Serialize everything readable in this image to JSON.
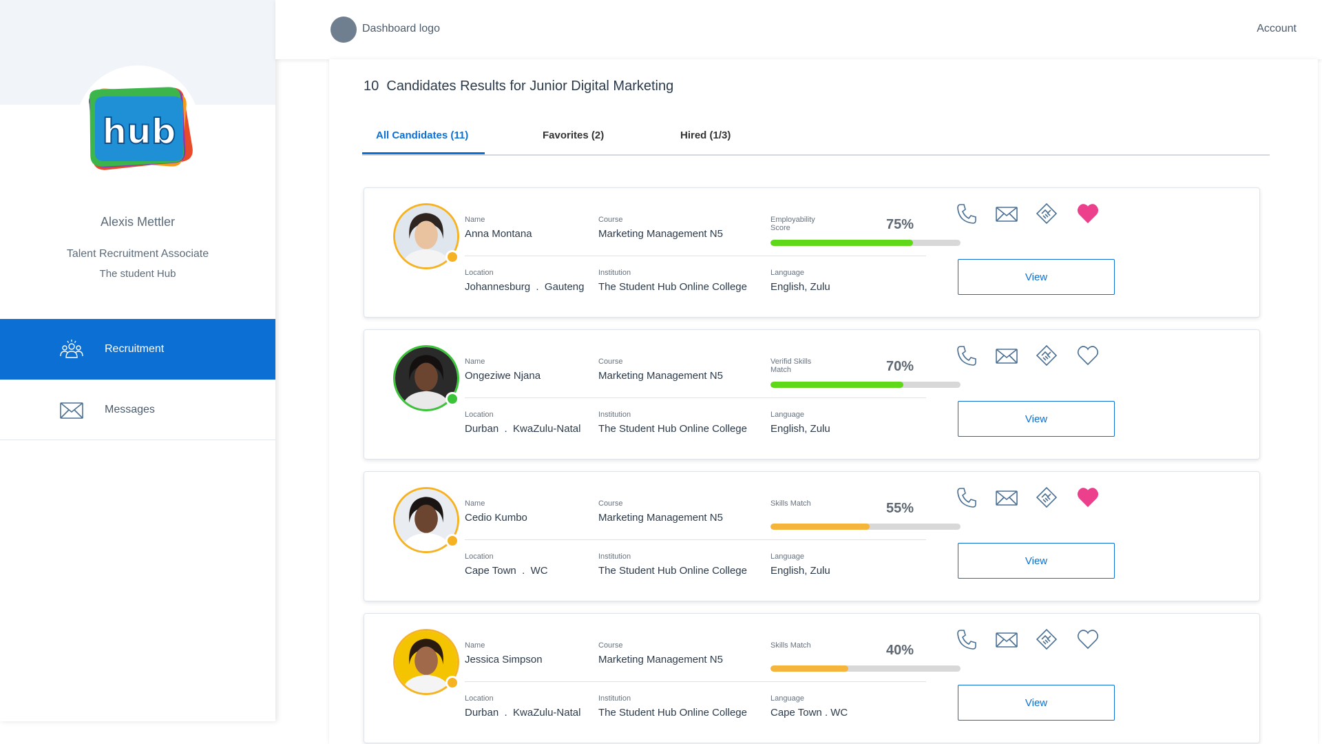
{
  "sidebar": {
    "profile": {
      "name": "Alexis Mettler",
      "role": "Talent Recruitment Associate",
      "organization": "The student Hub"
    },
    "logo_text": "hub",
    "nav": [
      {
        "label": "Recruitment",
        "icon": "people-group-icon",
        "active": true
      },
      {
        "label": "Messages",
        "icon": "envelope-icon",
        "active": false
      }
    ]
  },
  "header": {
    "logo_text": "Dashboard logo",
    "account_label": "Account"
  },
  "main": {
    "results_count": "10",
    "results_title": "Candidates Results for Junior Digital Marketing",
    "tabs": [
      {
        "label": "All Candidates (11)",
        "active": true
      },
      {
        "label": "Favorites (2)",
        "active": false
      },
      {
        "label": "Hired (1/3)",
        "active": false
      }
    ],
    "field_labels": {
      "name": "Name",
      "course": "Course",
      "location": "Location",
      "institution": "Institution",
      "language": "Language"
    },
    "view_label": "View",
    "candidates": [
      {
        "name": "Anna Montana",
        "course": "Marketing Management N5",
        "location_city": "Johannesburg",
        "location_region": "Gauteng",
        "institution": "The Student Hub Online College",
        "language": "English, Zulu",
        "score_label": "Employability Score",
        "score_value": "75%",
        "score_fraction": 0.75,
        "score_color": "#5fd81a",
        "status_color": "orange",
        "favorited": true
      },
      {
        "name": "Ongeziwe Njana",
        "course": "Marketing Management N5",
        "location_city": "Durban",
        "location_region": "KwaZulu-Natal",
        "institution": "The Student Hub Online College",
        "language": "English, Zulu",
        "score_label": "Verifid Skills Match",
        "score_value": "70%",
        "score_fraction": 0.7,
        "score_color": "#5fd81a",
        "status_color": "green",
        "favorited": false
      },
      {
        "name": "Cedio Kumbo",
        "course": "Marketing Management N5",
        "location_city": "Cape Town",
        "location_region": "WC",
        "institution": "The Student Hub Online College",
        "language": "English, Zulu",
        "score_label": "Skills Match",
        "score_value": "55%",
        "score_fraction": 0.52,
        "score_color": "#f5b43c",
        "status_color": "orange",
        "favorited": true
      },
      {
        "name": "Jessica Simpson",
        "course": "Marketing Management N5",
        "location_city": "Durban",
        "location_region": "KwaZulu-Natal",
        "institution": "The Student Hub Online College",
        "language": "Cape Town . WC",
        "score_label": "Skills Match",
        "score_value": "40%",
        "score_fraction": 0.41,
        "score_color": "#f5b43c",
        "status_color": "orange",
        "favorited": false
      }
    ]
  },
  "colors": {
    "accent": "#0b6fd3",
    "heart_favorite": "#ec3f8c",
    "sidebar_top": "#f1f4f8"
  }
}
